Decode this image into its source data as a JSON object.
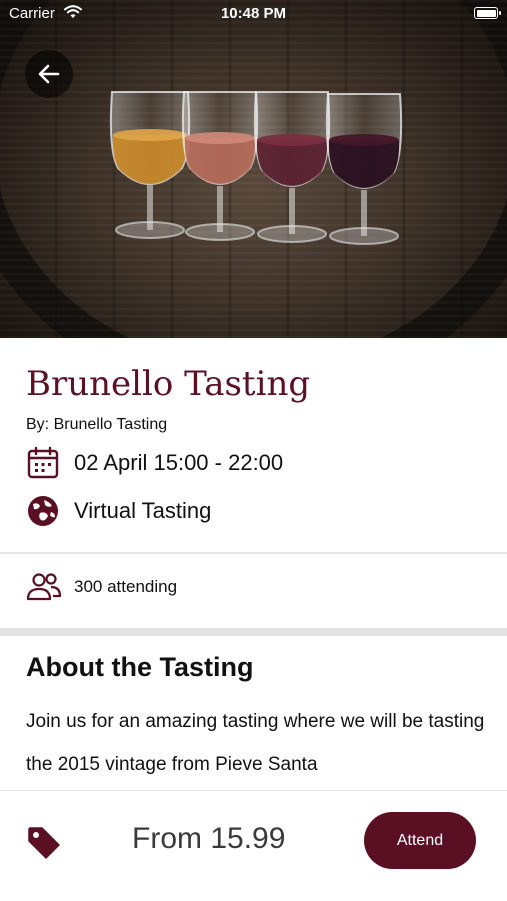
{
  "status_bar": {
    "carrier": "Carrier",
    "time": "10:48 PM",
    "battery_level": 1.0
  },
  "hero": {
    "image_description_icon": "wine-glasses-on-barrel-photo"
  },
  "event": {
    "title": "Brunello Tasting",
    "by_line": "By: Brunello Tasting",
    "date_time": "02 April 15:00 - 22:00",
    "venue": "Virtual Tasting",
    "attending": "300 attending"
  },
  "about": {
    "heading": "About the Tasting",
    "text": "Join us for an amazing tasting where we will be tasting the 2015 vintage from Pieve Santa"
  },
  "footer": {
    "price": "From 15.99",
    "attend_label": "Attend"
  },
  "colors": {
    "accent": "#5a0f22",
    "title": "#5a1124"
  },
  "icons": {
    "back": "arrow-left-icon",
    "calendar": "calendar-icon",
    "globe": "globe-icon",
    "people": "people-icon",
    "tag": "price-tag-icon"
  }
}
